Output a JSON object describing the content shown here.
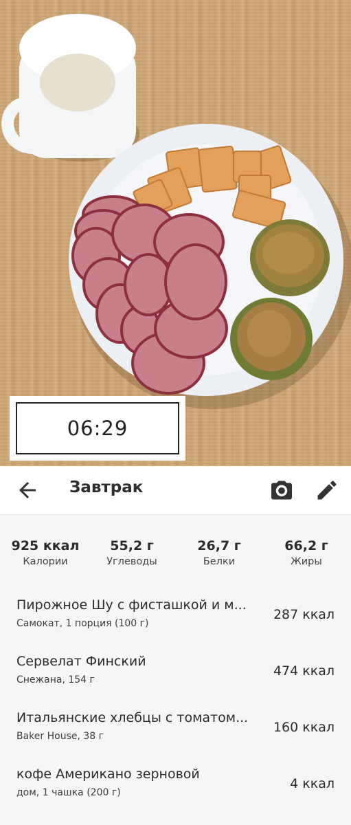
{
  "photo": {
    "time": "06:29"
  },
  "appbar": {
    "title": "Завтрак"
  },
  "summary": {
    "calories": {
      "value": "925 ккал",
      "label": "Калории"
    },
    "carbs": {
      "value": "55,2 г",
      "label": "Углеводы"
    },
    "protein": {
      "value": "26,7 г",
      "label": "Белки"
    },
    "fat": {
      "value": "66,2 г",
      "label": "Жиры"
    }
  },
  "items": [
    {
      "name": "Пирожное Шу с фисташкой и м...",
      "sub": "Самокат, 1 порция (100 г)",
      "kcal": "287 ккал"
    },
    {
      "name": "Сервелат Финский",
      "sub": "Снежана, 154 г",
      "kcal": "474 ккал"
    },
    {
      "name": "Итальянские хлебцы с томатом...",
      "sub": "Baker House, 38 г",
      "kcal": "160 ккал"
    },
    {
      "name": "кофе Американо зерновой",
      "sub": "дом, 1 чашка (200 г)",
      "kcal": "4 ккал"
    }
  ]
}
